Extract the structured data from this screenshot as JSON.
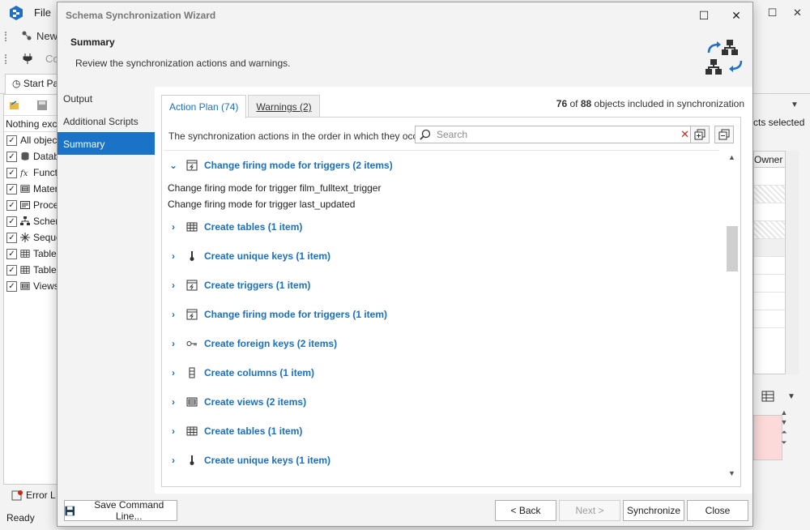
{
  "background_app": {
    "menu_file": "File",
    "toolbar_new": "New",
    "toolbar_co": "Co",
    "start_page_tab": "Start Pa",
    "left_tree_header": "Nothing exclu",
    "left_tree_items": [
      {
        "label": "All objec",
        "icon": "none"
      },
      {
        "label": "Datab",
        "icon": "database-icon"
      },
      {
        "label": "Funct",
        "icon": "function-icon"
      },
      {
        "label": "Mater",
        "icon": "view-icon"
      },
      {
        "label": "Proce",
        "icon": "procedure-icon"
      },
      {
        "label": "Scher",
        "icon": "schema-icon"
      },
      {
        "label": "Seque",
        "icon": "sequence-icon"
      },
      {
        "label": "Table",
        "icon": "table-icon"
      },
      {
        "label": "Table",
        "icon": "table-icon"
      },
      {
        "label": "Views",
        "icon": "view-icon"
      }
    ],
    "right_objects_selected": "cts selected",
    "right_owner_header": "Owner",
    "error_list_label": "Error L",
    "status_text": "Ready"
  },
  "dialog": {
    "title": "Schema Synchronization Wizard",
    "header_title": "Summary",
    "header_subtitle": "Review the synchronization actions and warnings.",
    "nav_items": [
      {
        "label": "Output",
        "active": false
      },
      {
        "label": "Additional Scripts",
        "active": false
      },
      {
        "label": "Summary",
        "active": true
      }
    ],
    "tabs": [
      {
        "label": "Action Plan (74)",
        "active": true
      },
      {
        "label": "Warnings (2)",
        "active": false
      }
    ],
    "object_count": {
      "included": "76",
      "of_text": "of",
      "total": "88",
      "suffix": "objects included in synchronization"
    },
    "description": "The synchronization actions in the order in which they occur.",
    "search_placeholder": "Search",
    "action_groups": [
      {
        "label": "Change firing mode for triggers (2 items)",
        "icon": "trigger-icon",
        "expanded": true,
        "details": [
          "Change firing mode for trigger film_fulltext_trigger",
          "Change firing mode for trigger last_updated"
        ]
      },
      {
        "label": "Create tables (1 item)",
        "icon": "table-icon",
        "expanded": false,
        "details": []
      },
      {
        "label": "Create unique keys (1 item)",
        "icon": "unique-key-icon",
        "expanded": false,
        "details": []
      },
      {
        "label": "Create triggers (1 item)",
        "icon": "trigger-icon",
        "expanded": false,
        "details": []
      },
      {
        "label": "Change firing mode for triggers (1 item)",
        "icon": "trigger-icon",
        "expanded": false,
        "details": []
      },
      {
        "label": "Create foreign keys (2 items)",
        "icon": "foreign-key-icon",
        "expanded": false,
        "details": []
      },
      {
        "label": "Create columns (1 item)",
        "icon": "column-icon",
        "expanded": false,
        "details": []
      },
      {
        "label": "Create views (2 items)",
        "icon": "view-icon",
        "expanded": false,
        "details": []
      },
      {
        "label": "Create tables (1 item)",
        "icon": "table-icon",
        "expanded": false,
        "details": []
      },
      {
        "label": "Create unique keys (1 item)",
        "icon": "unique-key-icon",
        "expanded": false,
        "details": []
      }
    ],
    "footer": {
      "save_command_line": "Save Command Line...",
      "back": "< Back",
      "next": "Next >",
      "synchronize": "Synchronize",
      "close": "Close"
    }
  }
}
